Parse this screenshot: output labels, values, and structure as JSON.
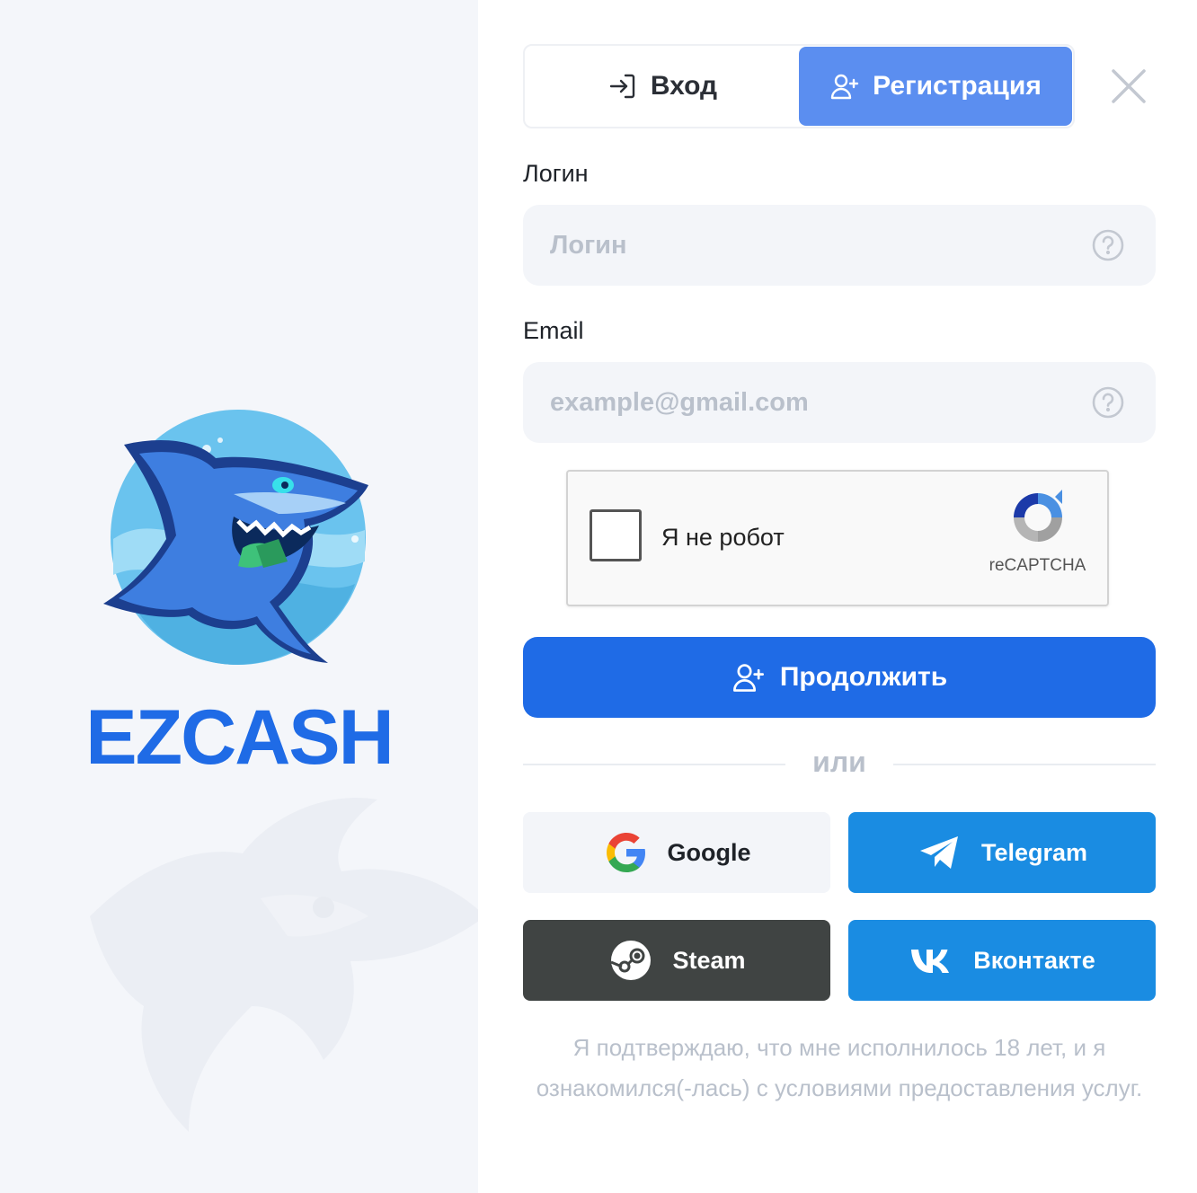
{
  "brand": {
    "name": "EZCASH"
  },
  "tabs": [
    {
      "label": "Вход",
      "icon": "login-icon",
      "active": false
    },
    {
      "label": "Регистрация",
      "icon": "user-plus-icon",
      "active": true
    }
  ],
  "form": {
    "login_label": "Логин",
    "login_placeholder": "Логин",
    "email_label": "Email",
    "email_placeholder": "example@gmail.com"
  },
  "captcha": {
    "label": "Я не робот",
    "brand": "reCAPTCHA"
  },
  "continue_label": "Продолжить",
  "divider_label": "или",
  "social": {
    "google": "Google",
    "telegram": "Telegram",
    "steam": "Steam",
    "vk": "Вконтакте"
  },
  "legal_text": "Я подтверждаю, что мне исполнилось 18 лет, и я ознакомился(-лась) с условиями предоставления услуг.",
  "colors": {
    "accent": "#1f6be6",
    "tab_active": "#5b8ef0",
    "telegram": "#1a8ce2",
    "vk": "#1a8ce2",
    "steam": "#404443",
    "brand_word": "#1f6be6"
  }
}
